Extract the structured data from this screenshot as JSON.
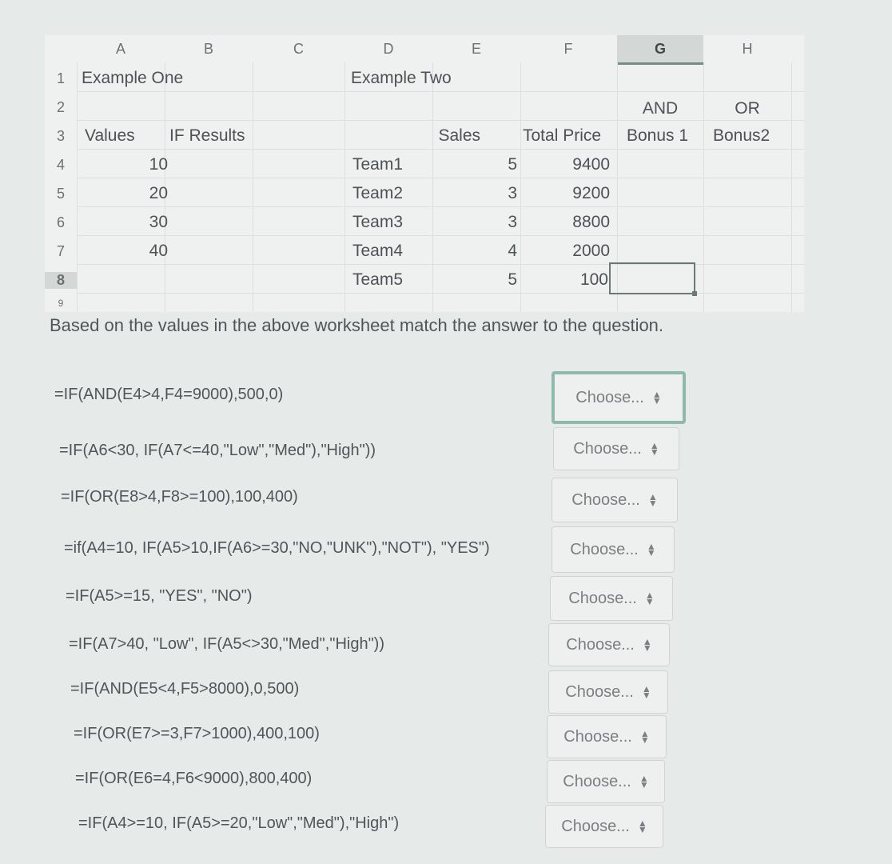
{
  "spreadsheet": {
    "columns": [
      "A",
      "B",
      "C",
      "D",
      "E",
      "F",
      "G",
      "H"
    ],
    "selected_column": "G",
    "rows": [
      "1",
      "2",
      "3",
      "4",
      "5",
      "6",
      "7",
      "8",
      "9"
    ],
    "cells": {
      "A1": "Example One",
      "D1": "Example Two",
      "G2": "AND",
      "H2": "OR",
      "A3": "Values",
      "B3": "IF Results",
      "E3": "Sales",
      "F3": "Total Price",
      "G3": "Bonus 1",
      "H3": "Bonus2",
      "A4": "10",
      "A5": "20",
      "A6": "30",
      "A7": "40",
      "D4": "Team1",
      "D5": "Team2",
      "D6": "Team3",
      "D7": "Team4",
      "D8": "Team5",
      "E4": "5",
      "E5": "3",
      "E6": "3",
      "E7": "4",
      "E8": "5",
      "F4": "9400",
      "F5": "9200",
      "F6": "8800",
      "F7": "2000",
      "F8": "100"
    },
    "active_cell": "G8"
  },
  "prompt": "Based on the values in the above worksheet match the answer to the question.",
  "questions": [
    {
      "formula": "=IF(AND(E4>4,F4=9000),500,0)",
      "answer": "Choose..."
    },
    {
      "formula": "=IF(A6<30, IF(A7<=40,\"Low\",\"Med\"),\"High\"))",
      "answer": "Choose..."
    },
    {
      "formula": "=IF(OR(E8>4,F8>=100),100,400)",
      "answer": "Choose..."
    },
    {
      "formula": "=if(A4=10, IF(A5>10,IF(A6>=30,\"NO,\"UNK\"),\"NOT\"), \"YES\")",
      "answer": "Choose..."
    },
    {
      "formula": "=IF(A5>=15, \"YES\", \"NO\")",
      "answer": "Choose..."
    },
    {
      "formula": "=IF(A7>40, \"Low\", IF(A5<>30,\"Med\",\"High\"))",
      "answer": "Choose..."
    },
    {
      "formula": "=IF(AND(E5<4,F5>8000),0,500)",
      "answer": "Choose..."
    },
    {
      "formula": "=IF(OR(E7>=3,F7>1000),400,100)",
      "answer": "Choose..."
    },
    {
      "formula": "=IF(OR(E6=4,F6<9000),800,400)",
      "answer": "Choose..."
    },
    {
      "formula": "=IF(A4>=10, IF(A5>=20,\"Low\",\"Med\"),\"High\")",
      "answer": "Choose..."
    }
  ]
}
